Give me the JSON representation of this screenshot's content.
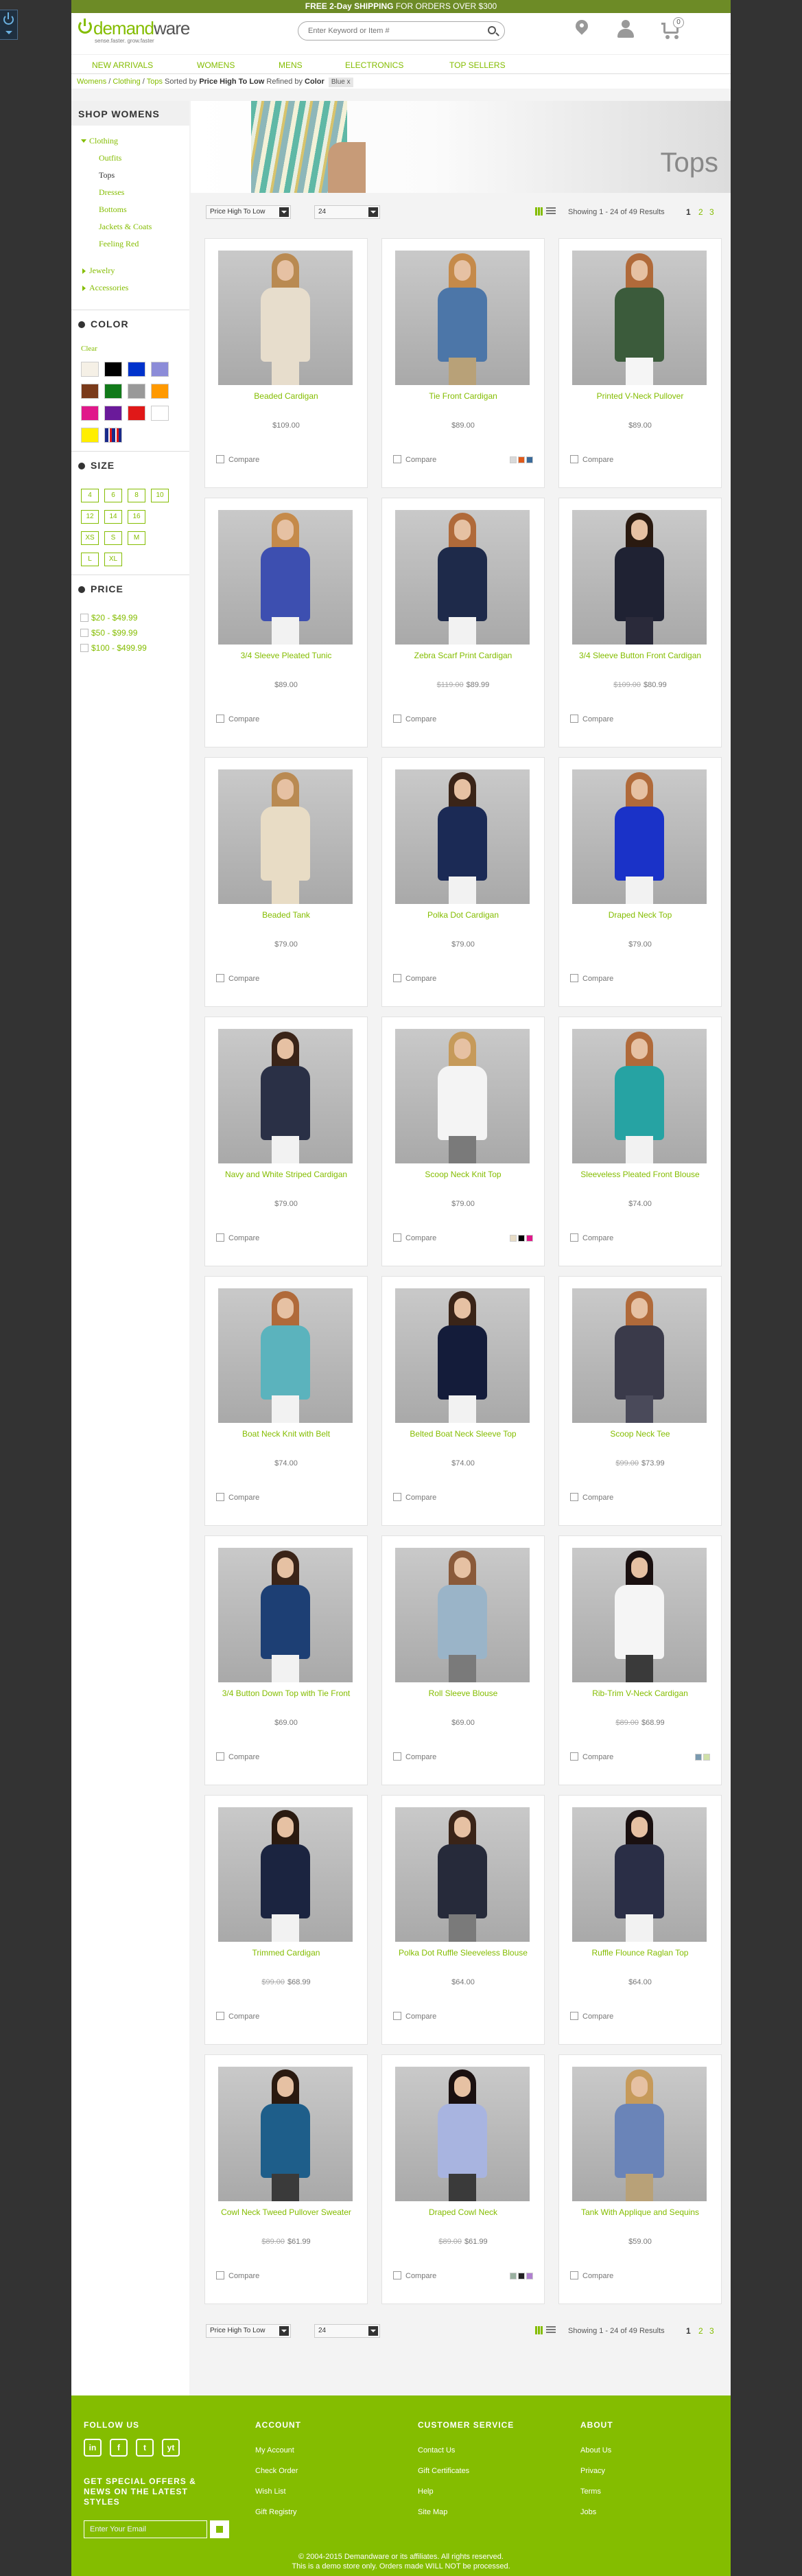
{
  "colors": {
    "accent": "#84bd00",
    "topbar": "#6d8b26",
    "page_bg": "#333333"
  },
  "topbar": {
    "bold": "FREE 2-Day SHIPPING",
    "rest": "FOR ORDERS OVER $300"
  },
  "logo": {
    "name_a": "demand",
    "name_b": "ware",
    "tagline": "sense.faster. grow.faster"
  },
  "search": {
    "placeholder": "Enter Keyword or Item #"
  },
  "cart": {
    "count": "0"
  },
  "nav": [
    "NEW ARRIVALS",
    "WOMENS",
    "MENS",
    "ELECTRONICS",
    "TOP SELLERS"
  ],
  "breadcrumb": {
    "items": [
      "Womens",
      "Clothing",
      "Tops"
    ],
    "sort_prefix": "Sorted by",
    "sort_value": "Price High To Low",
    "refined": "Refined by",
    "color_label": "Color",
    "chip": "Blue"
  },
  "sidebar": {
    "title": "SHOP WOMENS",
    "categories": {
      "clothing": "Clothing",
      "outfits": "Outfits",
      "tops": "Tops",
      "dresses": "Dresses",
      "bottoms": "Bottoms",
      "jackets": "Jackets & Coats",
      "feeling_red": "Feeling Red",
      "jewelry": "Jewelry",
      "accessories": "Accessories"
    },
    "color_title": "COLOR",
    "clear": "Clear",
    "swatches": [
      "#f5f0e6",
      "#000000",
      "#0033cc",
      "#8c8cd8",
      "#7a3a1a",
      "#117a1a",
      "#999999",
      "#ff9900",
      "#e0188a",
      "#6a1a9a",
      "#e01818",
      "#ffffff",
      "#ffee00",
      "miscellaneous"
    ],
    "size_title": "SIZE",
    "sizes": [
      "4",
      "6",
      "8",
      "10",
      "12",
      "14",
      "16",
      "XS",
      "S",
      "M",
      "L",
      "XL"
    ],
    "price_title": "PRICE",
    "prices": [
      "$20 - $49.99",
      "$50 - $99.99",
      "$100 - $499.99"
    ]
  },
  "hero": {
    "title": "Tops"
  },
  "toolbar": {
    "sort": "Price High To Low",
    "per_page": "24",
    "showing": "Showing 1 - 24 of 49 Results",
    "pages": [
      "1",
      "2",
      "3"
    ]
  },
  "compare_label": "Compare",
  "products": [
    {
      "name": "Beaded Cardigan",
      "price": "$109.00",
      "old": "",
      "top": "#e7ddcc",
      "legs": "#e7ddcc",
      "hair": "#b98a52",
      "sw": []
    },
    {
      "name": "Tie Front Cardigan",
      "price": "$89.00",
      "old": "",
      "top": "#4c76a8",
      "legs": "#b8a178",
      "hair": "#c58a4a",
      "sw": [
        "#d9d9d9",
        "#e05a1a",
        "#3a6a9a"
      ]
    },
    {
      "name": "Printed V-Neck Pullover",
      "price": "$89.00",
      "old": "",
      "top": "#3b5b3b",
      "legs": "#f5f5f5",
      "hair": "#b06a3a",
      "sw": []
    },
    {
      "name": "3/4 Sleeve Pleated Tunic",
      "price": "$89.00",
      "old": "",
      "top": "#3d4fb0",
      "legs": "#f2f2f2",
      "hair": "#c58a4a",
      "sw": []
    },
    {
      "name": "Zebra Scarf Print Cardigan",
      "price": "$89.99",
      "old": "$119.00",
      "top": "#1e2a4a",
      "legs": "#f2f2f2",
      "hair": "#b06a3a",
      "sw": []
    },
    {
      "name": "3/4 Sleeve Button Front Cardigan",
      "price": "$80.99",
      "old": "$109.00",
      "top": "#1f2233",
      "legs": "#2a2a3a",
      "hair": "#2a1a10",
      "sw": []
    },
    {
      "name": "Beaded Tank",
      "price": "$79.00",
      "old": "",
      "top": "#e8dcc5",
      "legs": "#e8dcc5",
      "hair": "#b98a52",
      "sw": []
    },
    {
      "name": "Polka Dot Cardigan",
      "price": "$79.00",
      "old": "",
      "top": "#1b2a55",
      "legs": "#f2f2f2",
      "hair": "#3a2418",
      "sw": []
    },
    {
      "name": "Draped Neck Top",
      "price": "$79.00",
      "old": "",
      "top": "#1a32c8",
      "legs": "#f2f2f2",
      "hair": "#b06a3a",
      "sw": []
    },
    {
      "name": "Navy and White Striped Cardigan",
      "price": "$79.00",
      "old": "",
      "top": "#2a3046",
      "legs": "#f2f2f2",
      "hair": "#3a2418",
      "sw": []
    },
    {
      "name": "Scoop Neck Knit Top",
      "price": "$79.00",
      "old": "",
      "top": "#f4f4f4",
      "legs": "#7a7a7a",
      "hair": "#c69a5a",
      "sw": [
        "#e8dcc5",
        "#000000",
        "#e0188a"
      ]
    },
    {
      "name": "Sleeveless Pleated Front Blouse",
      "price": "$74.00",
      "old": "",
      "top": "#26a3a3",
      "legs": "#f2f2f2",
      "hair": "#b06a3a",
      "sw": []
    },
    {
      "name": "Boat Neck Knit with Belt",
      "price": "$74.00",
      "old": "",
      "top": "#5bb3bd",
      "legs": "#f2f2f2",
      "hair": "#b06a3a",
      "sw": []
    },
    {
      "name": "Belted Boat Neck Sleeve Top",
      "price": "$74.00",
      "old": "",
      "top": "#141c3a",
      "legs": "#f2f2f2",
      "hair": "#3a2418",
      "sw": []
    },
    {
      "name": "Scoop Neck Tee",
      "price": "$73.99",
      "old": "$99.00",
      "top": "#3a3a4a",
      "legs": "#4a4a5a",
      "hair": "#b06a3a",
      "sw": []
    },
    {
      "name": "3/4 Button Down Top with Tie Front",
      "price": "$69.00",
      "old": "",
      "top": "#1d3f74",
      "legs": "#f2f2f2",
      "hair": "#3a2418",
      "sw": []
    },
    {
      "name": "Roll Sleeve Blouse",
      "price": "$69.00",
      "old": "",
      "top": "#9ab4c8",
      "legs": "#7a7a7a",
      "hair": "#8a5a3a",
      "sw": []
    },
    {
      "name": "Rib-Trim V-Neck Cardigan",
      "price": "$68.99",
      "old": "$89.00",
      "top": "#f5f5f5",
      "legs": "#3a3a3a",
      "hair": "#1a1010",
      "sw": [
        "#7a9ab0",
        "#cfe0a8"
      ]
    },
    {
      "name": "Trimmed Cardigan",
      "price": "$68.99",
      "old": "$99.00",
      "top": "#1b2440",
      "legs": "#f2f2f2",
      "hair": "#2a1a10",
      "sw": []
    },
    {
      "name": "Polka Dot Ruffle Sleeveless Blouse",
      "price": "$64.00",
      "old": "",
      "top": "#262a3a",
      "legs": "#7a7a7a",
      "hair": "#3a2418",
      "sw": []
    },
    {
      "name": "Ruffle Flounce Raglan Top",
      "price": "$64.00",
      "old": "",
      "top": "#2a2e46",
      "legs": "#f2f2f2",
      "hair": "#1a1010",
      "sw": []
    },
    {
      "name": "Cowl Neck Tweed Pullover Sweater",
      "price": "$61.99",
      "old": "$89.00",
      "top": "#1e5e8a",
      "legs": "#3a3a3a",
      "hair": "#2a1a10",
      "sw": []
    },
    {
      "name": "Draped Cowl Neck",
      "price": "$61.99",
      "old": "$89.00",
      "top": "#a8b4e0",
      "legs": "#3a3a3a",
      "hair": "#1a1010",
      "sw": [
        "#9ab0a0",
        "#222222",
        "#b080d0"
      ]
    },
    {
      "name": "Tank With Applique and Sequins",
      "price": "$59.00",
      "old": "",
      "top": "#6a84b8",
      "legs": "#b8a178",
      "hair": "#c69a5a",
      "sw": []
    }
  ],
  "footer": {
    "follow": "FOLLOW US",
    "social": [
      "in",
      "f",
      "t",
      "yt"
    ],
    "news": "GET SPECIAL OFFERS & NEWS ON THE LATEST STYLES",
    "email_placeholder": "Enter Your Email",
    "account_title": "ACCOUNT",
    "account": [
      "My Account",
      "Check Order",
      "Wish List",
      "Gift Registry"
    ],
    "service_title": "CUSTOMER SERVICE",
    "service": [
      "Contact Us",
      "Gift Certificates",
      "Help",
      "Site Map"
    ],
    "about_title": "ABOUT",
    "about": [
      "About Us",
      "Privacy",
      "Terms",
      "Jobs"
    ],
    "copy1": "© 2004-2015 Demandware or its affiliates. All rights reserved.",
    "copy2": "This is a demo store only. Orders made WILL NOT be processed."
  }
}
